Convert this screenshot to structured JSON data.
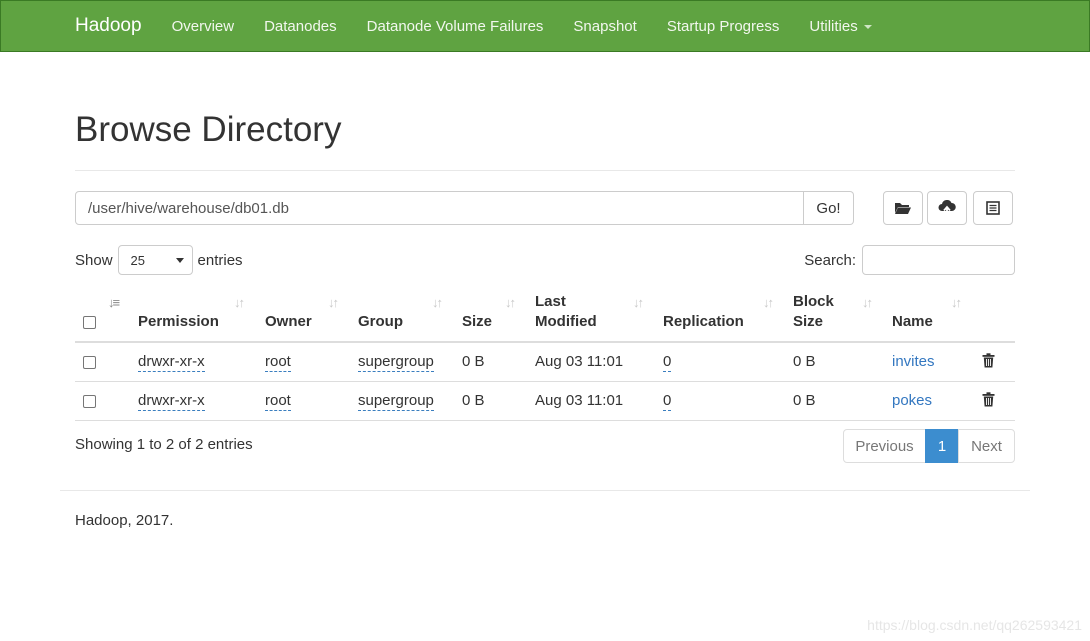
{
  "navbar": {
    "brand": "Hadoop",
    "items": [
      "Overview",
      "Datanodes",
      "Datanode Volume Failures",
      "Snapshot",
      "Startup Progress",
      "Utilities"
    ]
  },
  "page": {
    "title": "Browse Directory",
    "path_value": "/user/hive/warehouse/db01.db",
    "go_label": "Go!"
  },
  "controls": {
    "show_label": "Show",
    "page_size": "25",
    "entries_label": "entries",
    "search_label": "Search:"
  },
  "table": {
    "headers": [
      "Permission",
      "Owner",
      "Group",
      "Size",
      "Last",
      "Modified",
      "Replication",
      "Block",
      "Size",
      "Name"
    ],
    "rows": [
      {
        "permission": "drwxr-xr-x",
        "owner": "root",
        "group": "supergroup",
        "size": "0 B",
        "modified": "Aug 03 11:01",
        "replication": "0",
        "block_size": "0 B",
        "name": "invites"
      },
      {
        "permission": "drwxr-xr-x",
        "owner": "root",
        "group": "supergroup",
        "size": "0 B",
        "modified": "Aug 03 11:01",
        "replication": "0",
        "block_size": "0 B",
        "name": "pokes"
      }
    ]
  },
  "pagination": {
    "info": "Showing 1 to 2 of 2 entries",
    "previous": "Previous",
    "current": "1",
    "next": "Next"
  },
  "footer": {
    "text": "Hadoop, 2017."
  },
  "watermark": "https://blog.csdn.net/qq262593421",
  "colors": {
    "navbar": "#5fa341",
    "link": "#3377c0",
    "active_page": "#3c8dcf"
  }
}
